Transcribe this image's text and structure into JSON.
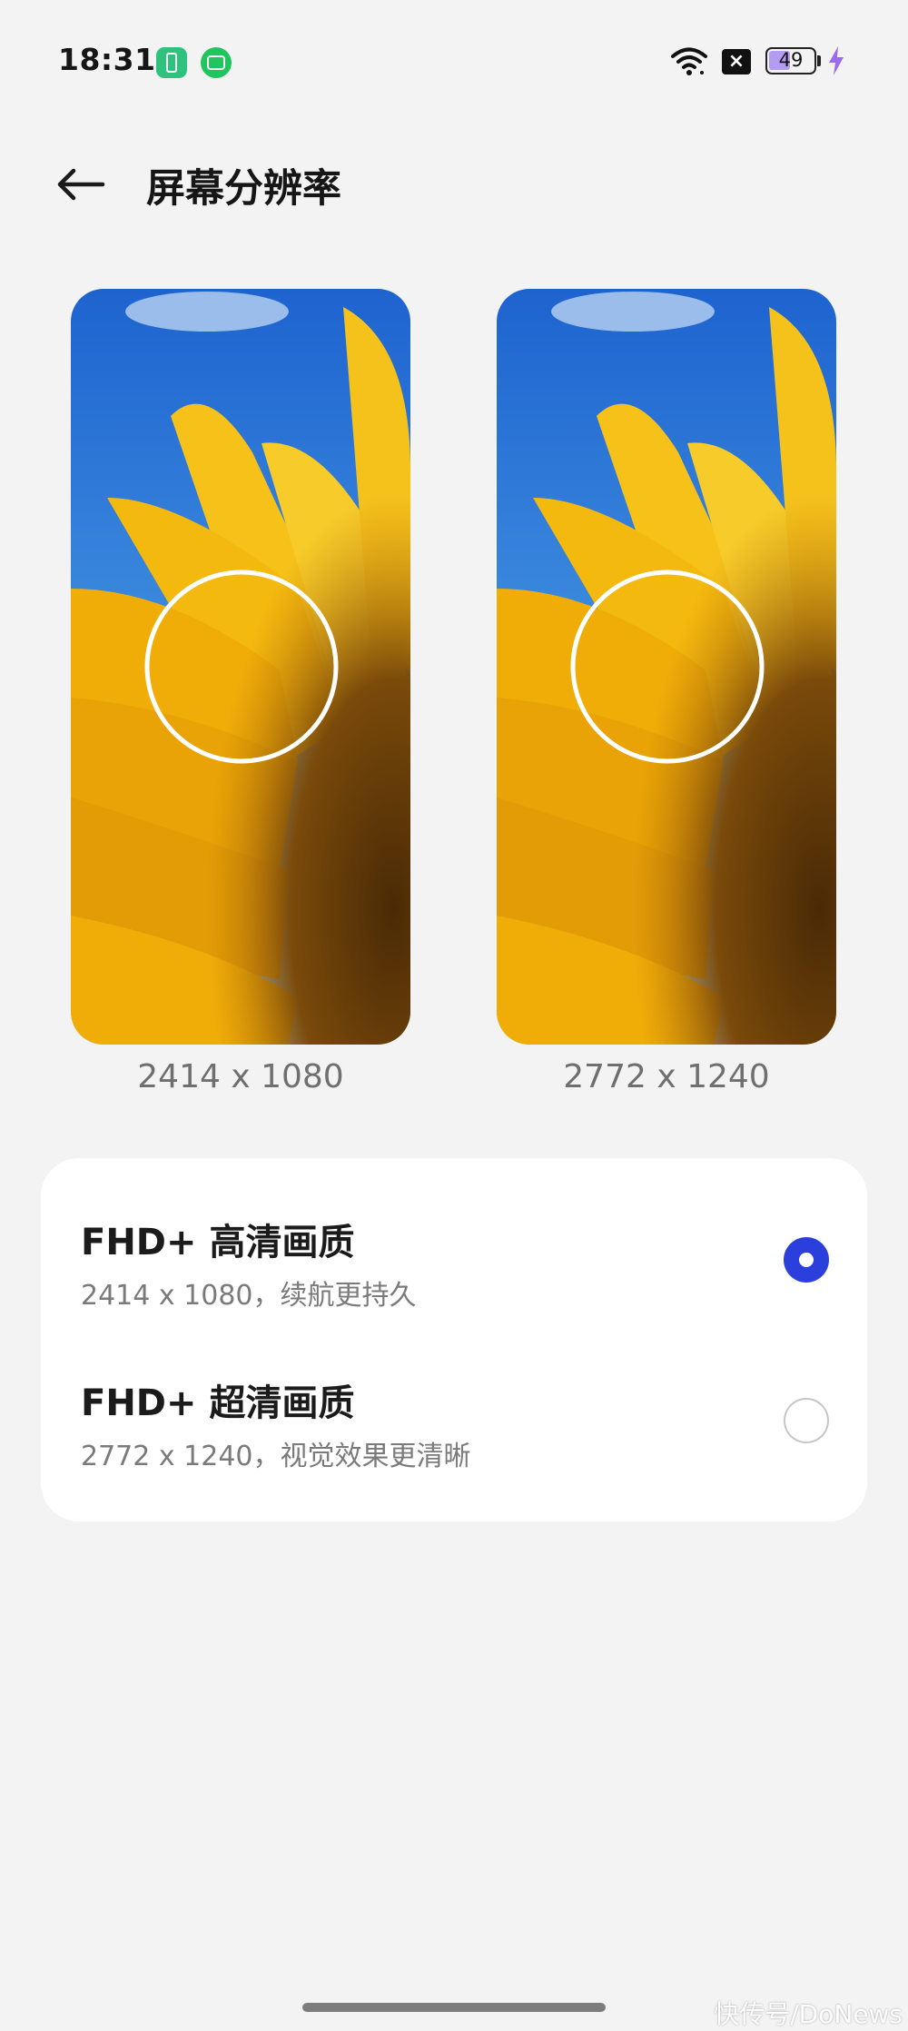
{
  "status_bar": {
    "time": "18:31",
    "battery_level": 49,
    "battery_text": "49",
    "icons": [
      "battery-saver-app-icon",
      "screen-app-icon",
      "wifi-icon",
      "no-sim-icon",
      "battery-icon",
      "charging-bolt-icon"
    ]
  },
  "header": {
    "back_icon": "back-arrow-icon",
    "title": "屏幕分辨率"
  },
  "previews": [
    {
      "resolution": "2414 x 1080"
    },
    {
      "resolution": "2772 x 1240"
    }
  ],
  "options": [
    {
      "title": "FHD+ 高清画质",
      "subtitle": "2414 x 1080，续航更持久",
      "selected": true
    },
    {
      "title": "FHD+ 超清画质",
      "subtitle": "2772 x 1240，视觉效果更清晰",
      "selected": false
    }
  ],
  "watermark": "快传号/DoNews",
  "colors": {
    "accent": "#2b3fdc",
    "background": "#f3f3f3",
    "card": "#ffffff",
    "battery_fill": "#b59cf3",
    "bolt": "#9b6cf0"
  }
}
